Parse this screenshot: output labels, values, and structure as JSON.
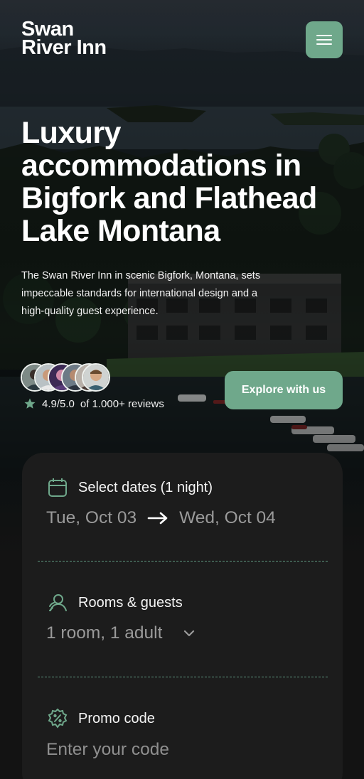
{
  "brand": {
    "line1": "Swan",
    "line2": "River Inn"
  },
  "hero": {
    "headline": "Luxury accommodations in Bigfork and Flathead Lake Montana",
    "description": "The Swan River Inn in scenic Bigfork, Montana, sets impeccable standards for international design and a high-quality guest experience.",
    "rating_score": "4.9/5.0",
    "rating_text": "of 1.000+ reviews",
    "cta_label": "Explore with us"
  },
  "booking": {
    "dates": {
      "label": "Select dates (1 night)",
      "check_in": "Tue, Oct 03",
      "check_out": "Wed, Oct 04"
    },
    "guests": {
      "label": "Rooms & guests",
      "value": "1 room, 1 adult"
    },
    "promo": {
      "label": "Promo code",
      "placeholder": "Enter your code"
    }
  },
  "colors": {
    "accent": "#6fa88b",
    "card_bg": "#1c1c1c",
    "page_bg": "#131313"
  },
  "icons": [
    "menu-icon",
    "star-icon",
    "calendar-icon",
    "arrow-right-icon",
    "guests-icon",
    "chevron-down-icon",
    "discount-icon"
  ]
}
